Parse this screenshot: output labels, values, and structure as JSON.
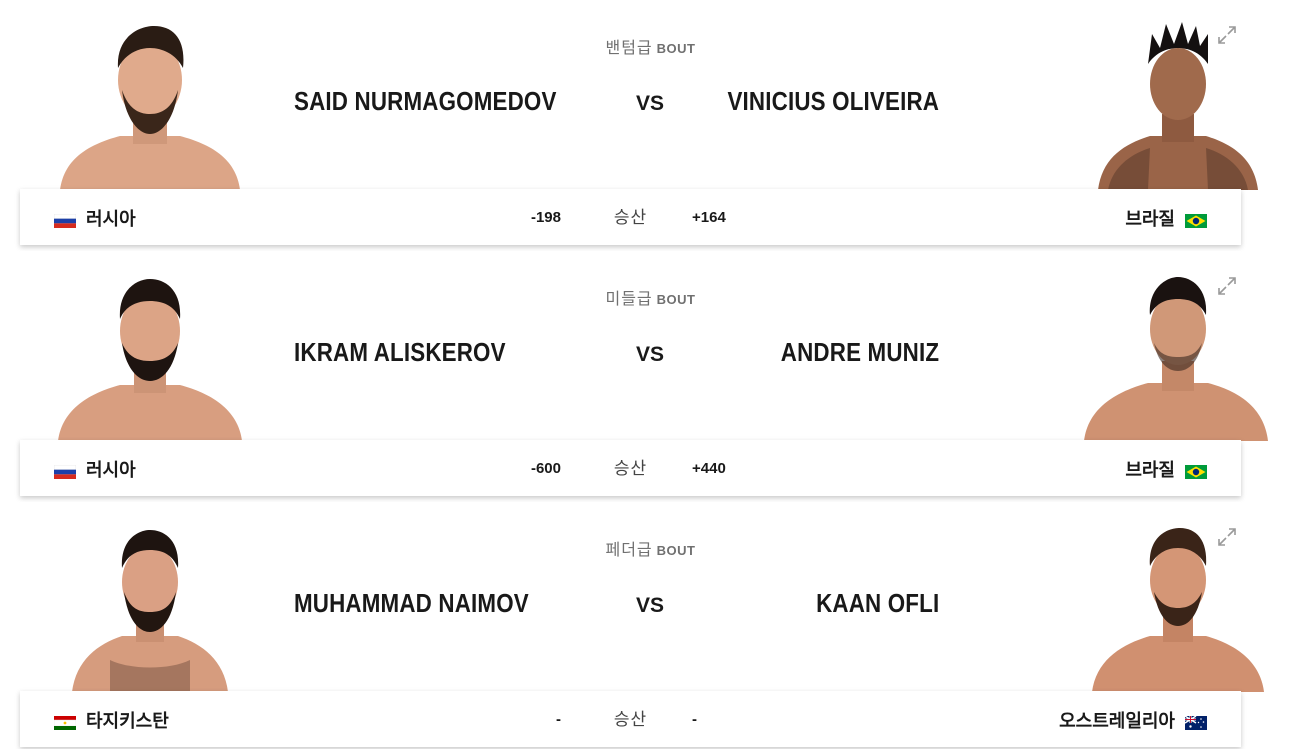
{
  "bouts": [
    {
      "weight_class": "밴텀급",
      "bout_label": "BOUT",
      "red": {
        "name": "SAID NURMAGOMEDOV",
        "country": "러시아",
        "odds": "-198",
        "flag": "russia"
      },
      "blue": {
        "name": "VINICIUS OLIVEIRA",
        "country": "브라질",
        "odds": "+164",
        "flag": "brazil"
      },
      "vs": "VS",
      "odds_label": "승산"
    },
    {
      "weight_class": "미들급",
      "bout_label": "BOUT",
      "red": {
        "name": "IKRAM ALISKEROV",
        "country": "러시아",
        "odds": "-600",
        "flag": "russia"
      },
      "blue": {
        "name": "ANDRE MUNIZ",
        "country": "브라질",
        "odds": "+440",
        "flag": "brazil"
      },
      "vs": "VS",
      "odds_label": "승산"
    },
    {
      "weight_class": "페더급",
      "bout_label": "BOUT",
      "red": {
        "name": "MUHAMMAD NAIMOV",
        "country": "타지키스탄",
        "odds": "-",
        "flag": "tajikistan"
      },
      "blue": {
        "name": "KAAN OFLI",
        "country": "오스트레일리아",
        "odds": "-",
        "flag": "australia"
      },
      "vs": "VS",
      "odds_label": "승산"
    }
  ],
  "icons": {
    "expand": "expand-icon",
    "portrait": "fighter-portrait"
  },
  "colors": {
    "text": "#191919",
    "muted": "#707070",
    "skin": "#e0a888",
    "hair": "#2a1c14"
  }
}
